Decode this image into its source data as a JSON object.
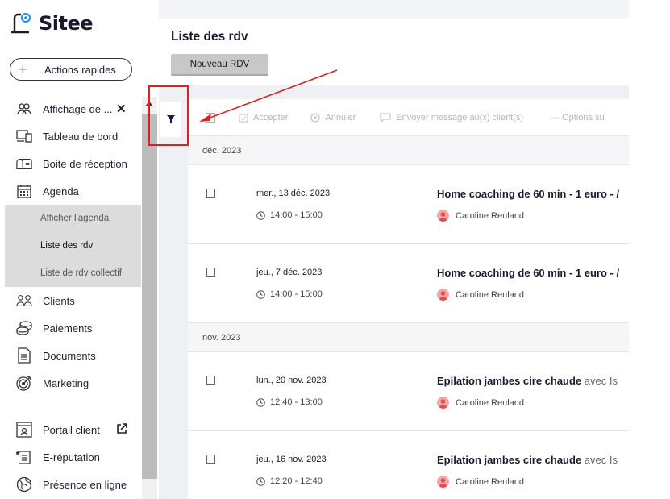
{
  "sidebar": {
    "logo_text": "Sitee",
    "quick_actions_label": "Actions rapides",
    "items": [
      {
        "label": "Affichage de ...",
        "icon": "users-group-icon"
      },
      {
        "label": "Tableau de bord",
        "icon": "dashboard-icon"
      },
      {
        "label": "Boite de réception",
        "icon": "mailbox-icon"
      },
      {
        "label": "Agenda",
        "icon": "calendar-icon"
      }
    ],
    "agenda_sub": [
      {
        "label": "Afficher l'agenda"
      },
      {
        "label": "Liste des rdv"
      },
      {
        "label": "Liste de rdv collectif"
      }
    ],
    "items2": [
      {
        "label": "Clients",
        "icon": "clients-icon"
      },
      {
        "label": "Paiements",
        "icon": "coins-icon"
      },
      {
        "label": "Documents",
        "icon": "document-icon"
      },
      {
        "label": "Marketing",
        "icon": "target-icon"
      }
    ],
    "items3": [
      {
        "label": "Portail client",
        "icon": "portal-icon"
      },
      {
        "label": "E-réputation",
        "icon": "reputation-icon"
      },
      {
        "label": "Présence en ligne",
        "icon": "globe-icon"
      }
    ]
  },
  "header": {
    "title": "Liste des rdv",
    "new_button": "Nouveau RDV"
  },
  "toolbar": {
    "accept": "Accepter",
    "cancel": "Annuler",
    "message": "Envoyer message au(x) client(s)",
    "options": "··· Options su"
  },
  "groups": [
    {
      "month": "déc. 2023",
      "appointments": [
        {
          "date": "mer., 13 déc. 2023",
          "time": "14:00 - 15:00",
          "title": "Home coaching de 60 min - 1 euro - /",
          "avec": "",
          "client": "Caroline Reuland"
        },
        {
          "date": "jeu., 7 déc. 2023",
          "time": "14:00 - 15:00",
          "title": "Home coaching de 60 min - 1 euro - /",
          "avec": "",
          "client": "Caroline Reuland"
        }
      ]
    },
    {
      "month": "nov. 2023",
      "appointments": [
        {
          "date": "lun., 20 nov. 2023",
          "time": "12:40 - 13:00",
          "title": "Epilation jambes cire chaude",
          "avec": " avec Is",
          "client": "Caroline Reuland"
        },
        {
          "date": "jeu., 16 nov. 2023",
          "time": "12:20 - 12:40",
          "title": "Epilation jambes cire chaude",
          "avec": " avec Is",
          "client": "Caroline Reuland"
        }
      ]
    }
  ],
  "colors": {
    "highlight": "#e02020",
    "avatar": "#f3a6a6",
    "accent": "#1a1a2e"
  }
}
